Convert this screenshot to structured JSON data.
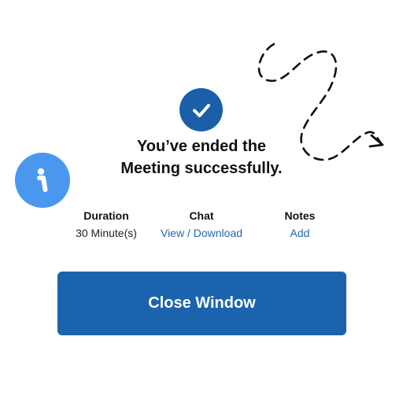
{
  "dialog": {
    "title_line1": "You’ve ended the",
    "title_line2": "Meeting successfully.",
    "success_icon": "check-icon",
    "info_icon": "info-icon",
    "decoration": "dashed-arrow"
  },
  "summary": {
    "duration": {
      "label": "Duration",
      "value": "30 Minute(s)"
    },
    "chat": {
      "label": "Chat",
      "view_label": "View",
      "separator": "/",
      "download_label": "Download"
    },
    "notes": {
      "label": "Notes",
      "add_label": "Add"
    }
  },
  "actions": {
    "close_label": "Close Window"
  },
  "colors": {
    "primary": "#1b64ad",
    "link": "#2467b0",
    "info": "#4a97f0",
    "text": "#111111"
  }
}
